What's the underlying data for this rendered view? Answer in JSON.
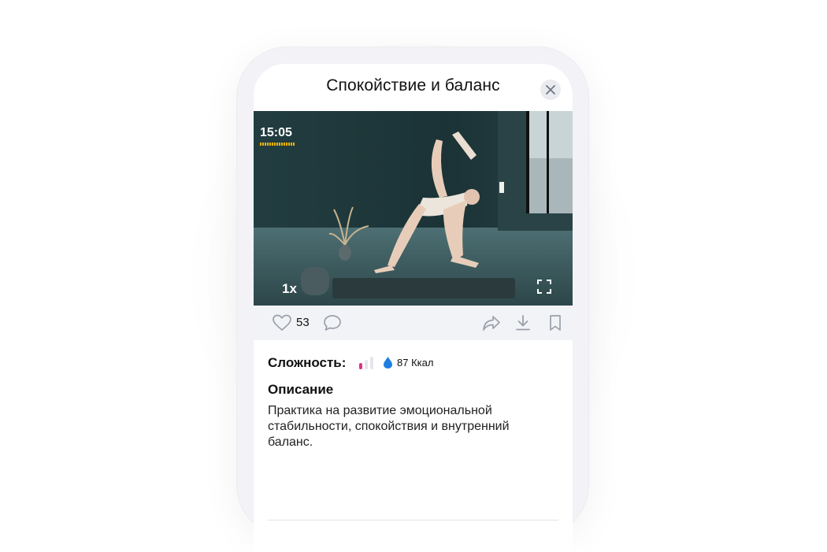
{
  "header": {
    "title": "Спокойствие и баланс"
  },
  "video": {
    "time": "15:05",
    "speed": "1x"
  },
  "actions": {
    "likes_count": "53"
  },
  "details": {
    "difficulty_label": "Сложность:",
    "calories": "87 Ккал",
    "description_title": "Описание",
    "description_text": "Практика на развитие эмоциональной стабильности, спокойствия и внутренний баланс."
  },
  "colors": {
    "accent_pink": "#e0308f",
    "accent_blue": "#1e7fe0",
    "progress_yellow": "#f0b400"
  },
  "icons": [
    "close-icon",
    "fullscreen-icon",
    "heart-icon",
    "comment-icon",
    "share-icon",
    "download-icon",
    "bookmark-icon",
    "drop-icon",
    "difficulty-bars-icon"
  ]
}
